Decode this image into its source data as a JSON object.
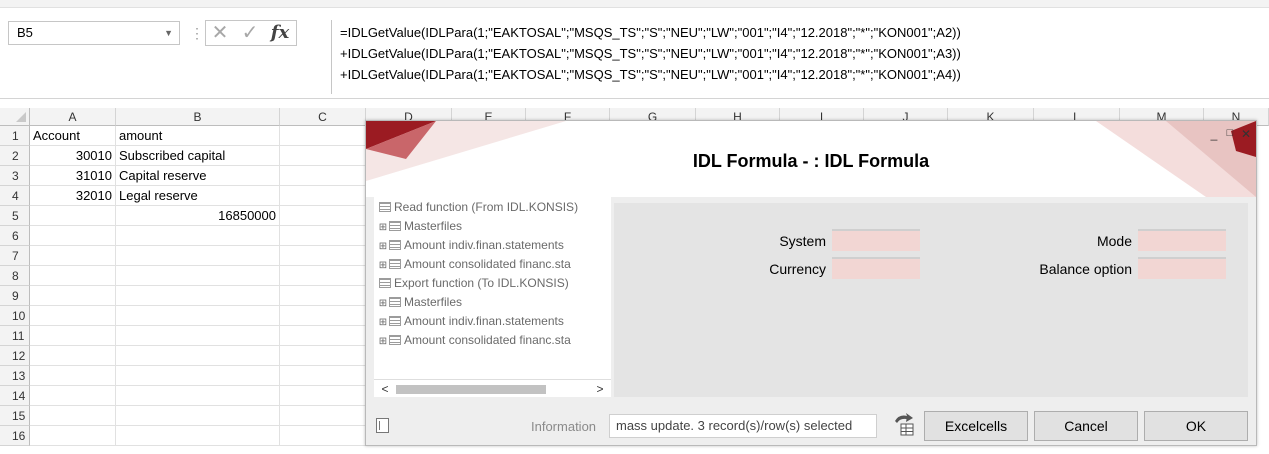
{
  "formula_bar": {
    "name_box": "B5",
    "cancel_glyph": "✕",
    "enter_glyph": "✓",
    "fx_label": "fx",
    "formula_lines": [
      "=IDLGetValue(IDLPara(1;\"EAKTOSAL\";\"MSQS_TS\";\"S\";\"NEU\";\"LW\";\"001\";\"I4\";\"12.2018\";\"*\";\"KON001\";A2))",
      "+IDLGetValue(IDLPara(1;\"EAKTOSAL\";\"MSQS_TS\";\"S\";\"NEU\";\"LW\";\"001\";\"I4\";\"12.2018\";\"*\";\"KON001\";A3))",
      "+IDLGetValue(IDLPara(1;\"EAKTOSAL\";\"MSQS_TS\";\"S\";\"NEU\";\"LW\";\"001\";\"I4\";\"12.2018\";\"*\";\"KON001\";A4))"
    ]
  },
  "sheet": {
    "columns": [
      "A",
      "B",
      "C",
      "D",
      "E",
      "F",
      "G",
      "H",
      "I",
      "J",
      "K",
      "L",
      "M",
      "N"
    ],
    "rows": [
      "1",
      "2",
      "3",
      "4",
      "5",
      "6",
      "7",
      "8",
      "9",
      "10",
      "11",
      "12",
      "13",
      "14",
      "15",
      "16"
    ],
    "cells": {
      "A1": "Account",
      "B1": "amount",
      "A2": "30010",
      "B2": "Subscribed capital",
      "A3": "31010",
      "B3": "Capital reserve",
      "A4": "32010",
      "B4": "Legal reserve",
      "B5": "16850000"
    }
  },
  "dialog": {
    "title": "IDL Formula -   : IDL Formula",
    "window_controls": {
      "minimize": "_",
      "maximize": "□",
      "close": "✕"
    },
    "tree": [
      {
        "expander": "",
        "label": "Read function (From IDL.KONSIS)"
      },
      {
        "expander": "⊞",
        "label": "Masterfiles"
      },
      {
        "expander": "⊞",
        "label": "Amount indiv.finan.statements"
      },
      {
        "expander": "⊞",
        "label": "Amount consolidated financ.sta"
      },
      {
        "expander": "",
        "label": "Export function (To IDL.KONSIS)"
      },
      {
        "expander": "⊞",
        "label": "Masterfiles"
      },
      {
        "expander": "⊞",
        "label": "Amount indiv.finan.statements"
      },
      {
        "expander": "⊞",
        "label": "Amount consolidated financ.sta"
      }
    ],
    "scroll_left": "<",
    "scroll_right": ">",
    "fields": {
      "system_label": "System",
      "system_value": "",
      "currency_label": "Currency",
      "currency_value": "",
      "mode_label": "Mode",
      "mode_value": "",
      "balance_label": "Balance option",
      "balance_value": ""
    },
    "info_label": "Information",
    "info_value": "mass update. 3 record(s)/row(s) selected",
    "buttons": {
      "excelcells": "Excelcells",
      "cancel": "Cancel",
      "ok": "OK"
    },
    "colors": {
      "accent_dark": "#9b1b22",
      "accent_light": "#e8c4c2",
      "field_fill": "#f2d6d3"
    }
  }
}
